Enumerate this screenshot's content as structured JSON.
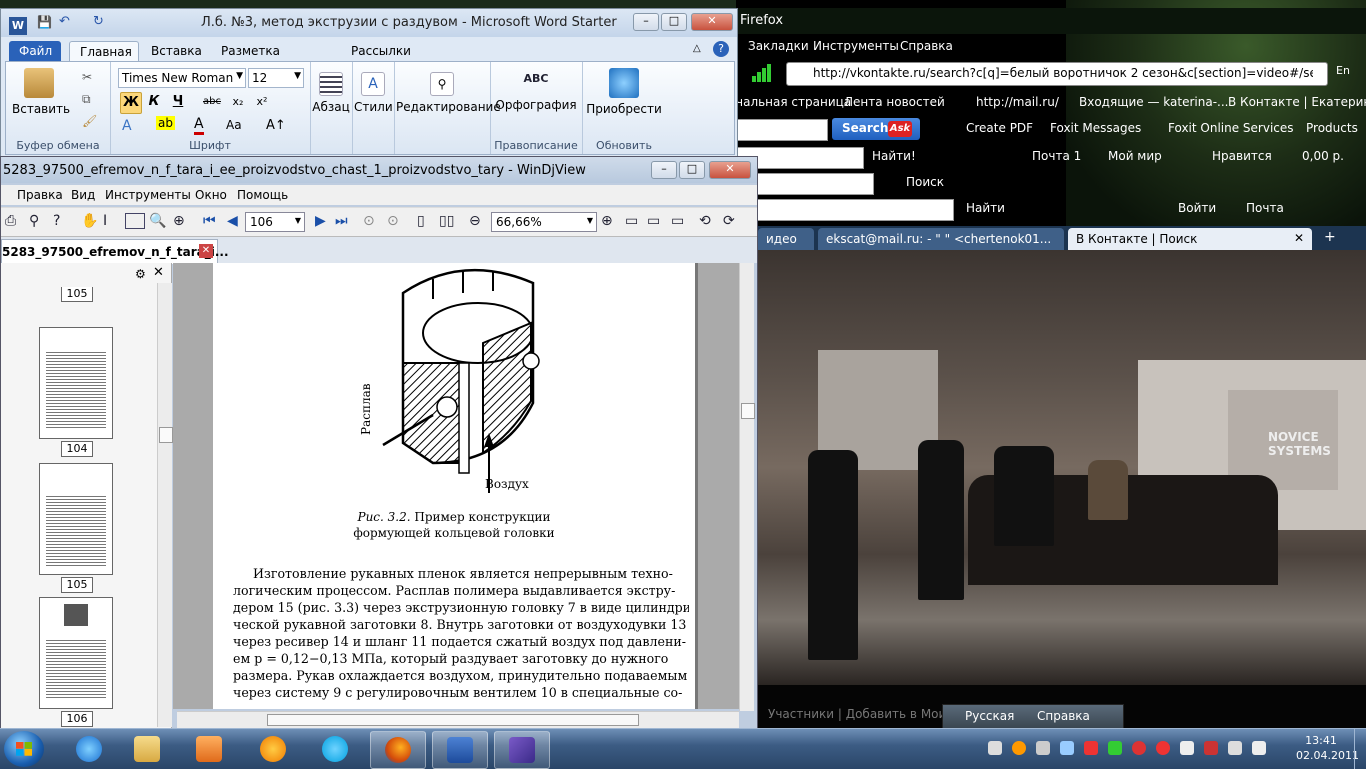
{
  "firefox": {
    "title": "Firefox",
    "menu": [
      "Закладки",
      "Инструменты",
      "Справка"
    ],
    "url": "http://vkontakte.ru/search?c[q]=белый воротничок 2 сезон&c[section]=video#/search?c|",
    "bookmarks": [
      "чальная страница",
      "Лента новостей",
      "http://mail.ru/",
      "Входящие — katerina-...",
      "В Контакте | Екатерин..."
    ],
    "search_button": "Search",
    "ask_label": "Ask",
    "toolbar2": [
      "Create PDF",
      "Foxit Messages",
      "Foxit Online Services",
      "Products"
    ],
    "toolbar3": {
      "find": "Найти!",
      "mail": "Почта 1",
      "myworld": "Мой мир",
      "like": "Нравится",
      "money": "0,00 р."
    },
    "toolbar4": {
      "search": "Поиск"
    },
    "toolbar5": {
      "find": "Найти",
      "login": "Войти",
      "mail": "Почта"
    },
    "lang": "En",
    "tabs": [
      "идео",
      "ekscat@mail.ru: - \" \" <chertenok01...",
      "В Контакте | Поиск"
    ],
    "video_sign": "NOVICE SYSTEMS",
    "under_video": "Участники |    Добавить в Мои Видеоза..."
  },
  "langbar": {
    "lang": "Русская",
    "help": "Справка"
  },
  "word": {
    "title": "Л.б. №3, метод экструзии с раздувом  -  Microsoft Word Starter",
    "logo": "W",
    "tabs": [
      "Файл",
      "Главная",
      "Вставка",
      "Разметка страницы",
      "Рассылки"
    ],
    "font_name": "Times New Roman",
    "font_size": "12",
    "buttons": {
      "paste": "Вставить",
      "paragraph": "Абзац",
      "styles": "Стили",
      "editing": "Редактирование",
      "spelling": "Орфография",
      "addins": "Приобрести"
    },
    "format": [
      "Ж",
      "К",
      "Ч",
      "abc",
      "x₂",
      "x²"
    ],
    "groups": [
      "Буфер обмена",
      "Шрифт",
      "Правописание",
      "Обновить"
    ],
    "spell_icon": "ABC"
  },
  "windjview": {
    "title": "5283_97500_efremov_n_f_tara_i_ee_proizvodstvo_chast_1_proizvodstvo_tary - WinDjView",
    "menu": [
      "Правка",
      "Вид",
      "Инструменты",
      "Окно",
      "Помощь"
    ],
    "page_number": "106",
    "zoom": "66,66%",
    "tab_label": "5283_97500_efremov_n_f_tara_i...",
    "thumb_pages": [
      "105",
      "104",
      "105",
      "106"
    ],
    "figure": {
      "label_melt": "Расплав",
      "label_air": "Воздух",
      "caption_num": "Рис. 3.2.",
      "caption_1": " Пример конструкции",
      "caption_2": "формующей кольцевой головки"
    },
    "paragraph": [
      "Изготовление рукавных пленок является непрерывным техно-",
      "логическим процессом. Расплав полимера выдавливается экстру-",
      "дером 15 (рис. 3.3) через экструзионную головку 7 в виде цилиндри-",
      "ческой рукавной заготовки 8. Внутрь заготовки от воздуходувки 13",
      "через ресивер 14 и шланг 11 подается сжатый воздух под давлени-",
      "ем p = 0,12−0,13 МПа, который раздувает заготовку до нужного",
      "размера. Рукав охлаждается воздухом, принудительно подаваемым",
      "через систему 9 с регулировочным вентилем 10 в специальные со-"
    ]
  },
  "clock": {
    "time": "13:41",
    "date": "02.04.2011"
  },
  "colors": {
    "taskbar": "#2a4668",
    "word_file_tab": "#2a62b9",
    "ff_tab_bar": "#1c3450"
  }
}
